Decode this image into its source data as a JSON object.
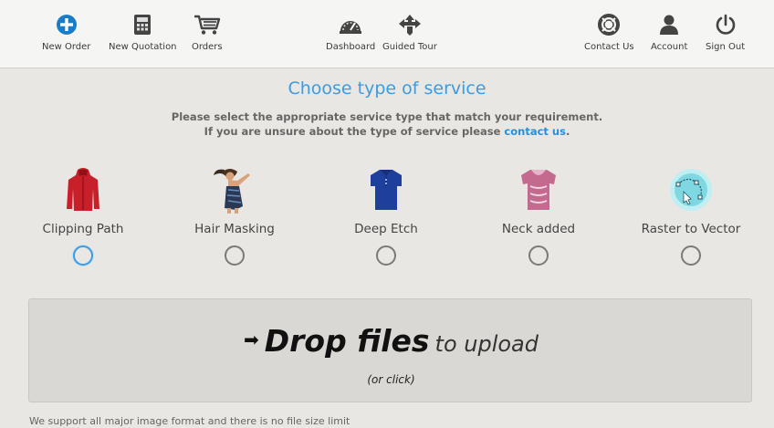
{
  "nav": {
    "new_order": "New Order",
    "new_quotation": "New Quotation",
    "orders": "Orders",
    "dashboard": "Dashboard",
    "guided_tour": "Guided Tour",
    "contact_us": "Contact Us",
    "account": "Account",
    "sign_out": "Sign Out",
    "icons": [
      "plus-circle-icon",
      "calculator-icon",
      "cart-icon",
      "dashboard-gauge-icon",
      "guided-tour-arrows-icon",
      "support-lifebuoy-icon",
      "user-icon",
      "power-icon"
    ],
    "accent_color": "#1a7cc4"
  },
  "heading": {
    "title": "Choose type of service",
    "line1": "Please select the appropriate service type that match your requirement.",
    "line2_prefix": "If you are unsure about the type of service please ",
    "line2_link": "contact us",
    "line2_suffix": "."
  },
  "services": [
    {
      "label": "Clipping Path",
      "icon": "red-jacket-icon",
      "selected": true
    },
    {
      "label": "Hair Masking",
      "icon": "woman-hair-icon",
      "selected": false
    },
    {
      "label": "Deep Etch",
      "icon": "blue-polo-shirt-icon",
      "selected": false
    },
    {
      "label": "Neck added",
      "icon": "pink-tshirt-icon",
      "selected": false
    },
    {
      "label": "Raster to Vector",
      "icon": "vector-path-icon",
      "selected": false
    }
  ],
  "dropzone": {
    "strong": "Drop files",
    "light": "to upload",
    "sub": "(or click)"
  },
  "footnote": "We support all major image format and there is no file size limit",
  "colors": {
    "title": "#3d9be0",
    "selected_radio": "#3d9be0",
    "background": "#e8e7e3"
  }
}
